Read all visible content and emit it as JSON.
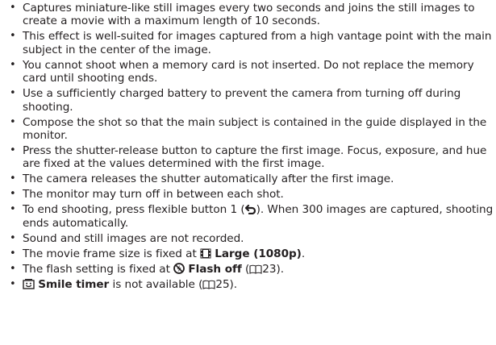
{
  "bullets": [
    {
      "text": "Captures miniature-like still images every two seconds and joins the still images to create a movie with a maximum length of 10 seconds."
    },
    {
      "text": "This effect is well-suited for images captured from a high vantage point with the main subject in the center of the image."
    },
    {
      "text": "You cannot shoot when a memory card is not inserted. Do not replace the memory card until shooting ends."
    },
    {
      "text": "Use a sufficiently charged battery to prevent the camera from turning off during shooting."
    },
    {
      "text": "Compose the shot so that the main subject is contained in the guide displayed in the monitor."
    },
    {
      "text": "Press the shutter-release button to capture the first image. Focus, exposure, and hue are fixed at the values determined with the first image."
    },
    {
      "text": "The camera releases the shutter automatically after the first image."
    },
    {
      "text": "The monitor may turn off in between each shot."
    },
    {
      "text_before": "To end shooting, press flexible button 1 (",
      "icon": "return-arrow-icon",
      "text_after": "). When 300 images are captured, shooting ends automatically."
    },
    {
      "text": "Sound and still images are not recorded."
    },
    {
      "text_before": "The movie frame size is fixed at ",
      "icon": "film-frame-icon",
      "bold": "Large (1080p)",
      "text_after": "."
    },
    {
      "text_before": "The flash setting is fixed at ",
      "icon": "flash-off-icon",
      "bold": "Flash off",
      "text_mid": " (",
      "ref_icon": "book-icon",
      "ref": "23",
      "text_after": ")."
    },
    {
      "icon": "smile-timer-icon",
      "bold": "Smile timer",
      "text_mid": " is not available (",
      "ref_icon": "book-icon",
      "ref": "25",
      "text_after": ")."
    }
  ],
  "bullet_char": "•",
  "colors": {
    "text": "#231f20"
  }
}
